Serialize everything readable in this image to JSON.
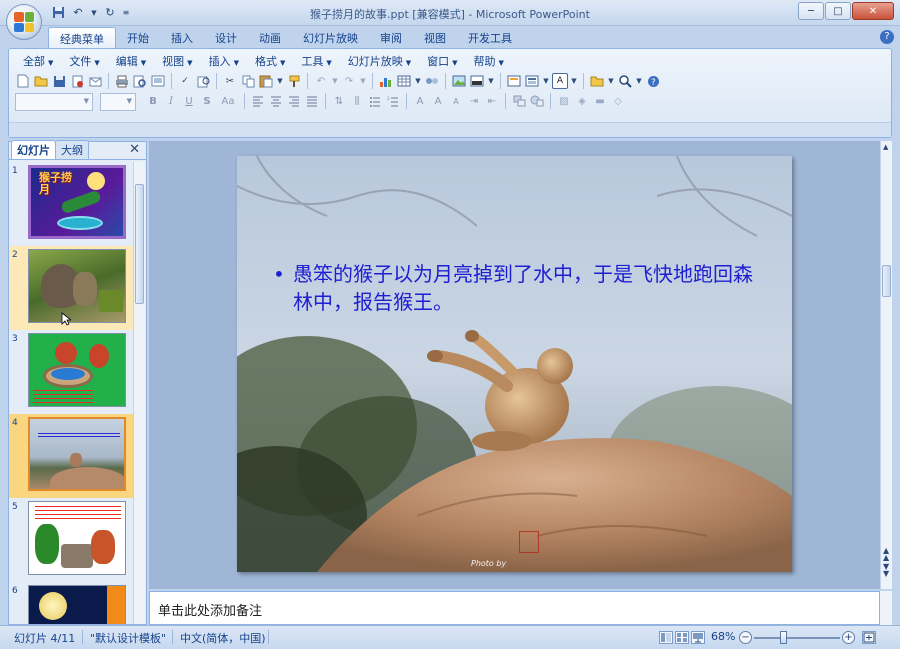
{
  "window": {
    "title": "猴子捞月的故事.ppt [兼容模式] - Microsoft PowerPoint",
    "minimize": "─",
    "maximize": "□",
    "close": "✕"
  },
  "ribbon_tabs": [
    "经典菜单",
    "开始",
    "插入",
    "设计",
    "动画",
    "幻灯片放映",
    "审阅",
    "视图",
    "开发工具"
  ],
  "help": "?",
  "classic_menus": [
    "全部",
    "文件",
    "编辑",
    "视图",
    "插入",
    "格式",
    "工具",
    "幻灯片放映",
    "窗口",
    "帮助"
  ],
  "panel": {
    "tab_slides": "幻灯片",
    "tab_outline": "大纲",
    "close": "✕"
  },
  "thumbnails": [
    {
      "num": "1",
      "text": "猴子捞月"
    },
    {
      "num": "2",
      "text": ""
    },
    {
      "num": "3",
      "text": ""
    },
    {
      "num": "4",
      "text": ""
    },
    {
      "num": "5",
      "text": ""
    },
    {
      "num": "6",
      "text": ""
    }
  ],
  "slide": {
    "bullet": "•",
    "text": "愚笨的猴子以为月亮掉到了水中，于是飞快地跑回森林中，报告猴王。",
    "photo_credit": "Photo by"
  },
  "notes": {
    "placeholder": "单击此处添加备注"
  },
  "status": {
    "slide_counter": "幻灯片 4/11",
    "theme": "\"默认设计模板\"",
    "language": "中文(简体，中国)",
    "zoom": "68%",
    "zoom_minus": "−",
    "zoom_plus": "+"
  },
  "colors": {
    "slide_text": "#1e1ed2",
    "selected_thumb": "#fbd680",
    "ribbon_border": "#8db2e3"
  }
}
